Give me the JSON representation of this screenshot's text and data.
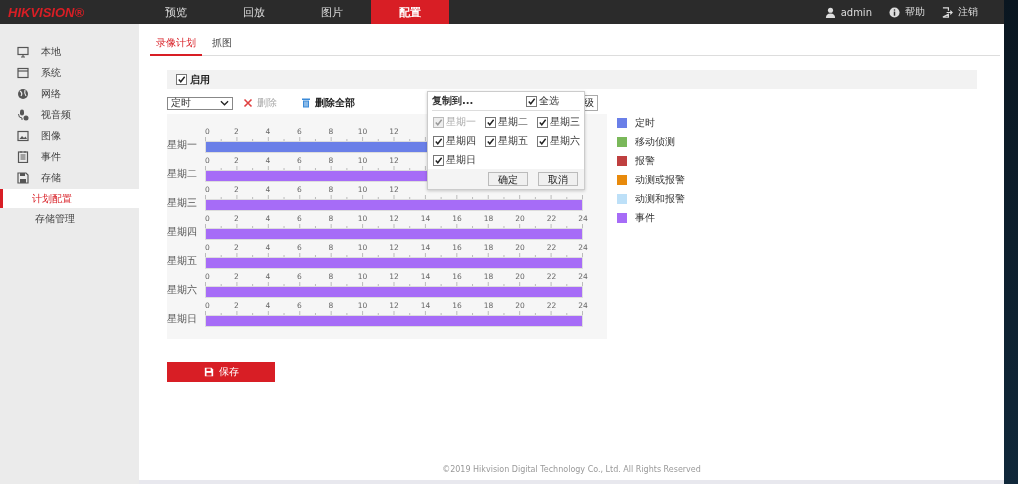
{
  "logo": "HIKVISION®",
  "nav": [
    {
      "label": "预览",
      "selected": false
    },
    {
      "label": "回放",
      "selected": false
    },
    {
      "label": "图片",
      "selected": false
    },
    {
      "label": "配置",
      "selected": true
    }
  ],
  "user": "admin",
  "help": "帮助",
  "logout": "注销",
  "sidebar": [
    {
      "label": "本地",
      "selected": false
    },
    {
      "label": "系统",
      "selected": false
    },
    {
      "label": "网络",
      "selected": false
    },
    {
      "label": "视音频",
      "selected": false
    },
    {
      "label": "图像",
      "selected": false
    },
    {
      "label": "事件",
      "selected": false
    },
    {
      "label": "存储",
      "selected": false,
      "children": [
        {
          "label": "计划配置",
          "selected": true
        },
        {
          "label": "存储管理",
          "selected": false
        }
      ]
    }
  ],
  "subtabs": [
    {
      "label": "录像计划",
      "selected": true
    },
    {
      "label": "抓图",
      "selected": false
    }
  ],
  "enable": {
    "label": "启用",
    "checked": true
  },
  "schedule_type": "定时",
  "toolbar": [
    {
      "kind": "delete",
      "label": "删除",
      "disabled": true
    },
    {
      "kind": "delete_all",
      "label": "删除全部",
      "disabled": false
    },
    {
      "kind": "advanced",
      "label": "级"
    }
  ],
  "days": [
    {
      "label": "星期一",
      "color": "#6a7fe8",
      "ticks": [
        "0",
        "2",
        "4",
        "6",
        "8",
        "10",
        "12"
      ]
    },
    {
      "label": "星期二",
      "color": "#a66cf7",
      "ticks": [
        "0",
        "2",
        "4",
        "6",
        "8",
        "10",
        "12"
      ]
    },
    {
      "label": "星期三",
      "color": "#a66cf7",
      "ticks": [
        "0",
        "2",
        "4",
        "6",
        "8",
        "10",
        "12"
      ]
    },
    {
      "label": "星期四",
      "color": "#a66cf7",
      "ticks": [
        "0",
        "2",
        "4",
        "6",
        "8",
        "10",
        "12",
        "14",
        "16",
        "18",
        "20",
        "22",
        "24"
      ]
    },
    {
      "label": "星期五",
      "color": "#a66cf7",
      "ticks": [
        "0",
        "2",
        "4",
        "6",
        "8",
        "10",
        "12",
        "14",
        "16",
        "18",
        "20",
        "22",
        "24"
      ]
    },
    {
      "label": "星期六",
      "color": "#a66cf7",
      "ticks": [
        "0",
        "2",
        "4",
        "6",
        "8",
        "10",
        "12",
        "14",
        "16",
        "18",
        "20",
        "22",
        "24"
      ]
    },
    {
      "label": "星期日",
      "color": "#a66cf7",
      "ticks": [
        "0",
        "2",
        "4",
        "6",
        "8",
        "10",
        "12",
        "14",
        "16",
        "18",
        "20",
        "22",
        "24"
      ]
    }
  ],
  "legend": [
    {
      "label": "定时",
      "color": "#6a7fe8"
    },
    {
      "label": "移动侦测",
      "color": "#7ab85a"
    },
    {
      "label": "报警",
      "color": "#bf4040"
    },
    {
      "label": "动测或报警",
      "color": "#e88a0c"
    },
    {
      "label": "动测和报警",
      "color": "#bde0f8"
    },
    {
      "label": "事件",
      "color": "#a66cf7"
    }
  ],
  "copy_popup": {
    "title": "复制到...",
    "select_all": {
      "label": "全选",
      "checked": true
    },
    "days": [
      {
        "label": "星期一",
        "checked": true,
        "disabled": true
      },
      {
        "label": "星期二",
        "checked": true,
        "disabled": false
      },
      {
        "label": "星期三",
        "checked": true,
        "disabled": false
      },
      {
        "label": "星期四",
        "checked": true,
        "disabled": false
      },
      {
        "label": "星期五",
        "checked": true,
        "disabled": false
      },
      {
        "label": "星期六",
        "checked": true,
        "disabled": false
      },
      {
        "label": "星期日",
        "checked": true,
        "disabled": false
      }
    ],
    "buttons": [
      "确定",
      "取消"
    ]
  },
  "save_button": "保存",
  "footer": "©2019 Hikvision Digital Technology Co., Ltd. All Rights Reserved"
}
